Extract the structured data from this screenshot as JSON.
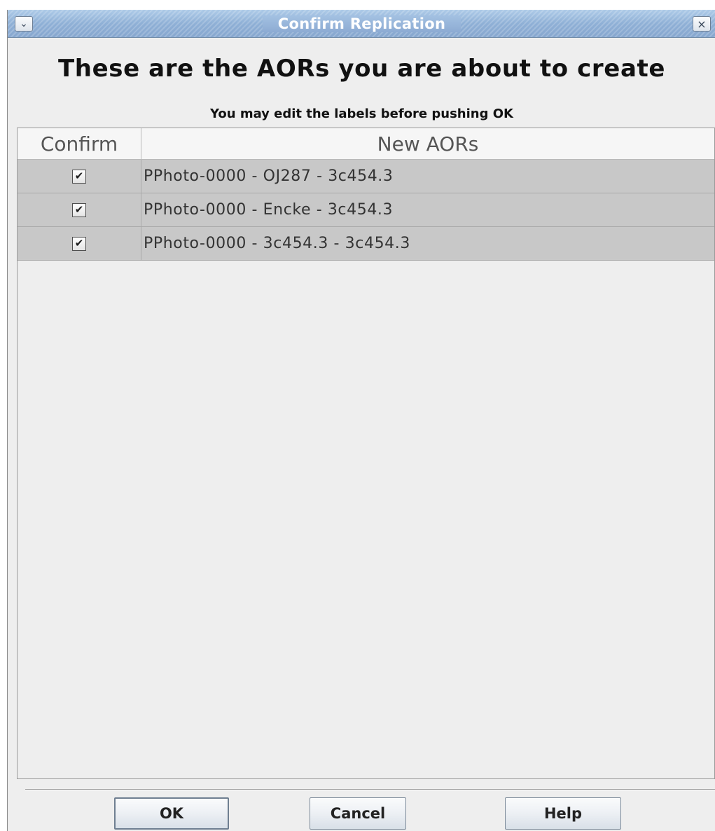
{
  "window": {
    "title": "Confirm Replication"
  },
  "titlebar": {
    "menu_icon": "chevron-down-icon",
    "close_icon": "close-icon"
  },
  "header": {
    "title": "These are the AORs you are about to create",
    "subtitle": "You may edit the labels before pushing OK"
  },
  "table": {
    "columns": [
      "Confirm",
      "New AORs"
    ],
    "rows": [
      {
        "confirmed": true,
        "label": "PPhoto-0000 - OJ287 - 3c454.3"
      },
      {
        "confirmed": true,
        "label": "PPhoto-0000 - Encke - 3c454.3"
      },
      {
        "confirmed": true,
        "label": "PPhoto-0000 - 3c454.3 - 3c454.3"
      }
    ]
  },
  "buttons": {
    "ok": "OK",
    "cancel": "Cancel",
    "help": "Help"
  },
  "colors": {
    "titlebar": "#8fb0d6",
    "row_background": "#c8c8c8",
    "window_background": "#eeeeee"
  }
}
